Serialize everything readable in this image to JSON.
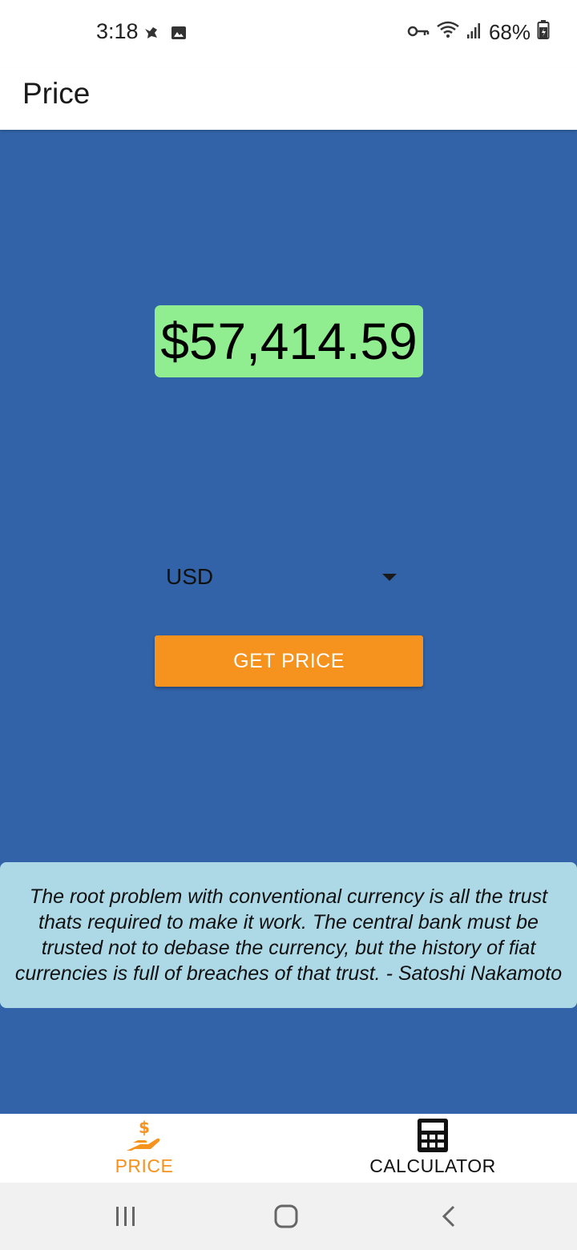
{
  "status_bar": {
    "time": "3:18",
    "battery": "68%"
  },
  "app_bar": {
    "title": "Price"
  },
  "main": {
    "price": "$57,414.59",
    "currency": "USD",
    "get_price_label": "GET PRICE",
    "quote": "The root problem with conventional currency is all the trust thats required to make it work. The central bank must be trusted not to debase the currency, but the history of fiat currencies is full of breaches of that trust. - Satoshi Nakamoto"
  },
  "bottom_nav": {
    "items": [
      {
        "label": "PRICE",
        "icon": "hand-dollar-icon",
        "active": true
      },
      {
        "label": "CALCULATOR",
        "icon": "calculator-icon",
        "active": false
      }
    ]
  },
  "system_nav": {
    "buttons": [
      "recent-apps-icon",
      "home-icon",
      "back-icon"
    ]
  },
  "colors": {
    "primary": "#3263a8",
    "price_bg": "#90ee90",
    "button": "#f6921e",
    "quote_bg": "#add8e6",
    "active_nav": "#f6921e"
  }
}
